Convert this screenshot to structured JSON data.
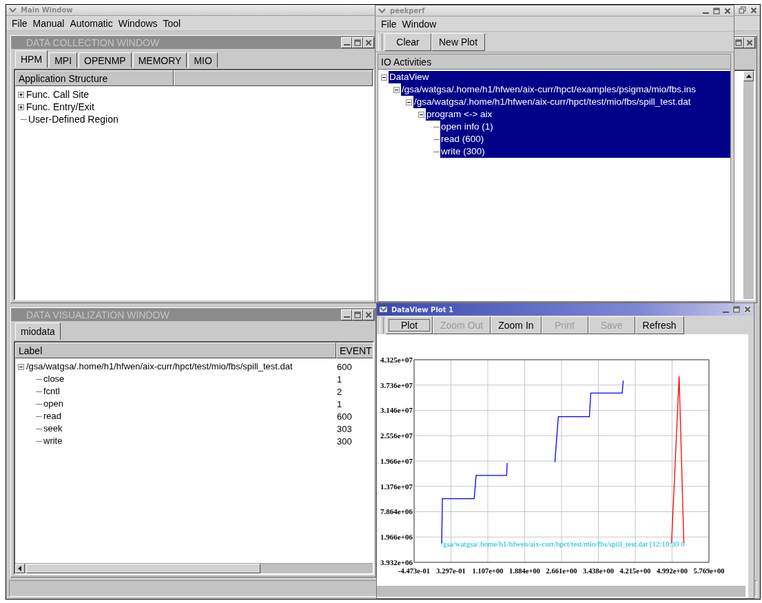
{
  "main_window": {
    "title": "Main Window",
    "menu": [
      "File",
      "Manual",
      "Automatic",
      "Windows",
      "Tool"
    ],
    "collection_window": {
      "title": "DATA COLLECTION WINDOW",
      "tabs": [
        {
          "label": "HPM",
          "selected": true
        },
        {
          "label": "MPI",
          "selected": false
        },
        {
          "label": "OPENMP",
          "selected": false
        },
        {
          "label": "MEMORY",
          "selected": false
        },
        {
          "label": "MIO",
          "selected": false
        }
      ],
      "columns": [
        "Application Structure"
      ],
      "tree": [
        {
          "label": "Func. Call Site",
          "expanded": false
        },
        {
          "label": "Func. Entry/Exit",
          "expanded": false
        },
        {
          "label": "User-Defined Region"
        }
      ]
    },
    "visualization_window": {
      "title": "DATA VISUALIZATION WINDOW",
      "tabs": [
        {
          "label": "miodata",
          "selected": true
        }
      ],
      "columns": [
        "Label",
        "EVENT"
      ],
      "tree": [
        {
          "label": "/gsa/watgsa/.home/h1/hfwen/aix-curr/hpct/test/mio/fbs/spill_test.dat",
          "event": "600",
          "expanded": true,
          "children": [
            {
              "label": "close",
              "event": "1"
            },
            {
              "label": "fcntl",
              "event": "2"
            },
            {
              "label": "open",
              "event": "1"
            },
            {
              "label": "read",
              "event": "600"
            },
            {
              "label": "seek",
              "event": "303"
            },
            {
              "label": "write",
              "event": "300"
            }
          ]
        }
      ]
    }
  },
  "peekperf": {
    "title": "peekperf",
    "menu": [
      "File",
      "Window"
    ],
    "toolbar": [
      "Clear",
      "New Plot"
    ],
    "panel_title": "IO Activities",
    "tree": [
      {
        "label": "DataView",
        "expanded": true,
        "selected": true,
        "children": [
          {
            "label": "/gsa/watgsa/.home/h1/hfwen/aix-curr/hpct/examples/psigma/mio/fbs.ins",
            "expanded": true,
            "selected": true,
            "children": [
              {
                "label": "/gsa/watgsa/.home/h1/hfwen/aix-curr/hpct/test/mio/fbs/spill_test.dat",
                "expanded": true,
                "selected": true,
                "children": [
                  {
                    "label": "program <-> aix",
                    "expanded": true,
                    "selected": true,
                    "children": [
                      {
                        "label": "open info (1)",
                        "selected": true
                      },
                      {
                        "label": "read (600)",
                        "selected": true
                      },
                      {
                        "label": "write (300)",
                        "selected": true
                      }
                    ]
                  }
                ]
              }
            ]
          }
        ]
      }
    ]
  },
  "plot_window": {
    "title": "DataView Plot 1",
    "toolbar": [
      {
        "label": "Plot",
        "pressed": true,
        "disabled": false
      },
      {
        "label": "Zoom Out",
        "pressed": false,
        "disabled": true
      },
      {
        "label": "Zoom In",
        "pressed": false,
        "disabled": false
      },
      {
        "label": "Print",
        "pressed": false,
        "disabled": true
      },
      {
        "label": "Save",
        "pressed": false,
        "disabled": true
      },
      {
        "label": "Refresh",
        "pressed": false,
        "disabled": false
      }
    ],
    "legend_label": "/gsa/watgsa/.home/h1/hfwen/aix-curr/hpct/test/mio/fbs/spill_test.dat [12:10:30 0",
    "chart_data": {
      "type": "line",
      "grid": true,
      "x": [
        0.135,
        0.149,
        0.819,
        0.862,
        1.503,
        1.517,
        2.521,
        2.594,
        3.249,
        3.278,
        3.94,
        3.962,
        4.98,
        5.14,
        5.24
      ],
      "series": [
        {
          "color": "#0000ff",
          "values": [
            500000,
            10900000,
            10900000,
            16300000,
            16300000,
            19200000,
            null,
            null,
            null,
            null,
            null,
            null,
            null,
            null,
            null
          ]
        },
        {
          "color": "#0000ff",
          "values": [
            null,
            null,
            null,
            null,
            null,
            null,
            19400000,
            30000000,
            30000000,
            35500000,
            35500000,
            38400000,
            null,
            null,
            null
          ]
        },
        {
          "color": "#ff0000",
          "values": [
            null,
            null,
            null,
            null,
            null,
            null,
            null,
            null,
            null,
            null,
            null,
            null,
            500000,
            39400000,
            500000
          ]
        }
      ],
      "xlim": [
        -0.4473,
        5.769
      ],
      "ylim": [
        -3932000,
        43250000
      ],
      "xticks": [
        {
          "value": -0.4473,
          "label": "-4.473e-01"
        },
        {
          "value": 0.3297,
          "label": "3.297e-01"
        },
        {
          "value": 1.107,
          "label": "1.107e+00"
        },
        {
          "value": 1.884,
          "label": "1.884e+00"
        },
        {
          "value": 2.661,
          "label": "2.661e+00"
        },
        {
          "value": 3.438,
          "label": "3.438e+00"
        },
        {
          "value": 4.215,
          "label": "4.215e+00"
        },
        {
          "value": 4.992,
          "label": "4.992e+00"
        },
        {
          "value": 5.769,
          "label": "5.769e+00"
        }
      ],
      "yticks": [
        {
          "value": 43250000,
          "label": "4.325e+07"
        },
        {
          "value": 37360000,
          "label": "3.736e+07"
        },
        {
          "value": 31460000,
          "label": "3.146e+07"
        },
        {
          "value": 25560000,
          "label": "2.556e+07"
        },
        {
          "value": 19660000,
          "label": "1.966e+07"
        },
        {
          "value": 13760000,
          "label": "1.376e+07"
        },
        {
          "value": 7864000,
          "label": "7.864e+06"
        },
        {
          "value": 1966000,
          "label": "1.966e+06"
        },
        {
          "value": -3932000,
          "label": "3.932e+06"
        }
      ]
    }
  }
}
